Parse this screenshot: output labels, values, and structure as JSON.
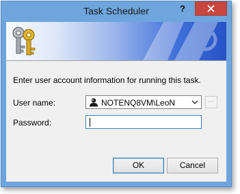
{
  "window": {
    "title": "Task Scheduler",
    "help_glyph": "?"
  },
  "banner": {
    "icon": "keys-icon"
  },
  "form": {
    "instruction": "Enter user account information for running this task.",
    "username_label": "User name:",
    "username_value": "NOTENQ8VM\\LeoN",
    "browse_label": "...",
    "password_label": "Password:",
    "password_value": ""
  },
  "buttons": {
    "ok": "OK",
    "cancel": "Cancel"
  },
  "colors": {
    "title_bar": "#6ea5dd",
    "close_button": "#c7463d",
    "banner_accent": "#2653c6",
    "focus_border": "#3c7fc4"
  }
}
